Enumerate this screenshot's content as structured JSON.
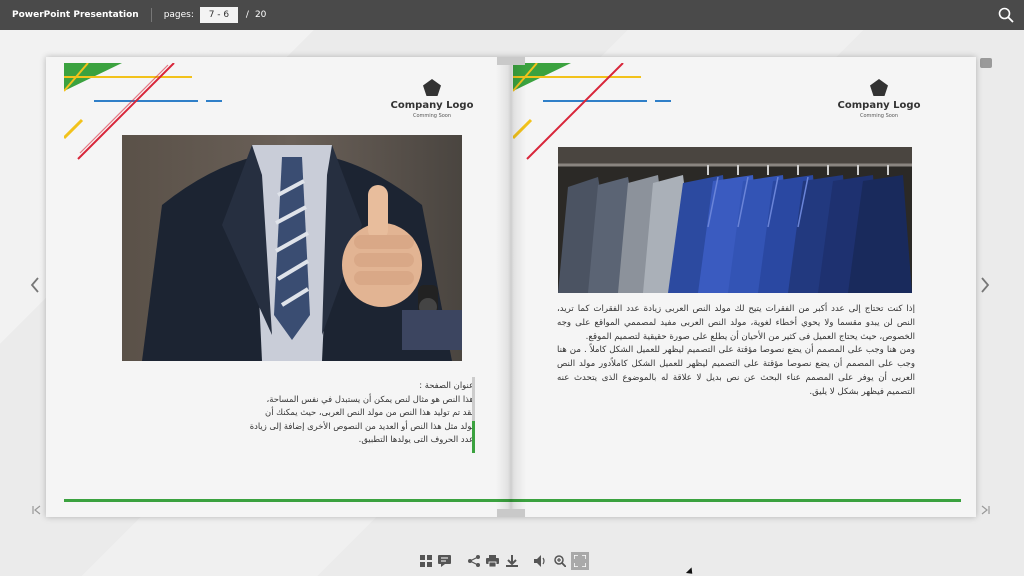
{
  "topbar": {
    "title": "PowerPoint Presentation",
    "pages_label": "pages:",
    "page_value": "7 - 6",
    "page_separator": "/",
    "page_total": "20"
  },
  "left_page": {
    "logo": {
      "name": "Company Logo",
      "tagline": "Comming Soon"
    },
    "photo_subject": "businessman in suit giving thumbs up",
    "caption": "عنوان الصفحة :\nهذا النص هو مثال لنص يمكن أن يستبدل في نفس المساحة،\nلقد تم توليد هذا النص من مولد النص العربى، حيث يمكنك أن\nتولد مثل هذا النص أو العديد من النصوص الأخرى إضافة إلى زيادة\nعدد الحروف التى يولدها التطبيق."
  },
  "right_page": {
    "logo": {
      "name": "Company Logo",
      "tagline": "Comming Soon"
    },
    "photo_subject": "row of suits on hangers",
    "body": "إذا كنت تحتاج إلى عدد أكبر من الفقرات يتيح لك مولد النص العربى زيادة عدد الفقرات كما تريد، النص لن يبدو مقسما ولا يحوي أخطاء لغوية، مولد النص العربى مفيد لمصممي المواقع على وجه الخصوص، حيث يحتاج العميل فى كثير من الأحيان أن يطلع على صورة حقيقية لتصميم الموقع.\nومن هنا وجب على المصمم أن يضع نصوصا مؤقتة على التصميم ليظهر للعميل الشكل كاملاً . من هنا وجب على المصمم أن يضع نصوصا مؤقتة على التصميم ليظهر للعميل الشكل كاملاًدور مولد النص العربى أن يوفر على المصمم عناء البحث عن نص بديل لا علاقة له بالموضوع الذى يتحدث عنه التصميم فيظهر بشكل لا يليق."
  },
  "icons": {
    "search": "search-icon",
    "prev": "chevron-left-icon",
    "next": "chevron-right-icon",
    "first": "first-page-icon",
    "last": "last-page-icon",
    "comment": "comment-icon",
    "toolbar": [
      "thumbnails-icon",
      "notes-icon",
      "share-icon",
      "print-icon",
      "download-icon",
      "sound-icon",
      "zoom-in-icon",
      "fullscreen-icon"
    ]
  },
  "colors": {
    "topbar": "#4a4a4a",
    "accent_green": "#3ba23f",
    "accent_red": "#d8263a",
    "accent_blue": "#2f7fc8",
    "accent_yellow": "#f2c21b"
  }
}
